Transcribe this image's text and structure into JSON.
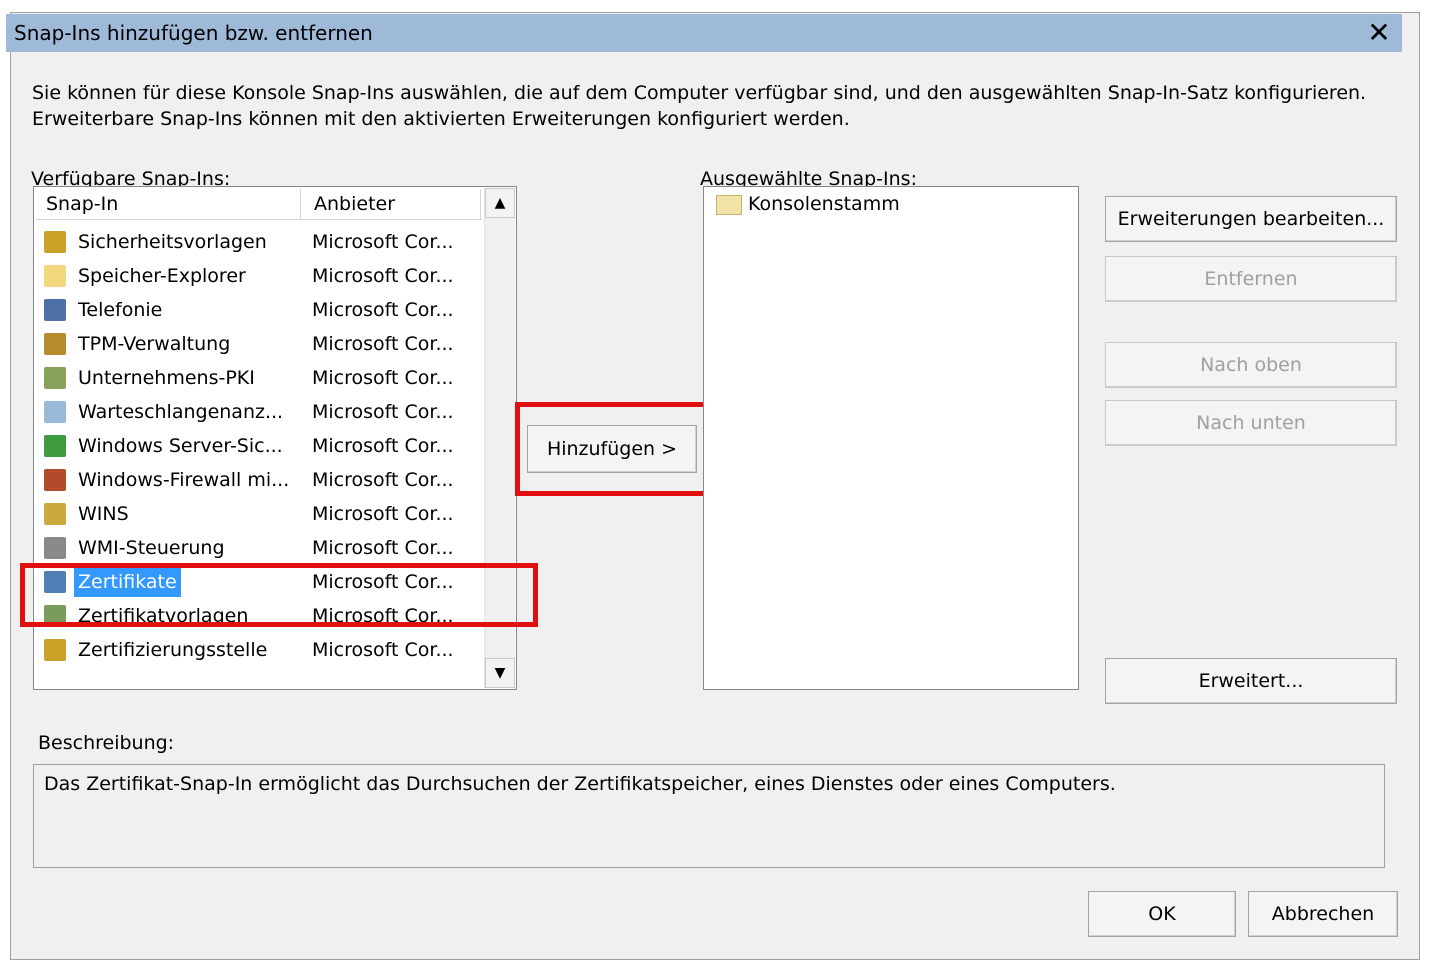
{
  "dialog": {
    "title": "Snap-Ins hinzufügen bzw. entfernen",
    "close_label": "✕",
    "intro": "Sie können für diese Konsole Snap-Ins auswählen, die auf dem Computer verfügbar sind, und den ausgewählten Snap-In-Satz konfigurieren. Erweiterbare Snap-Ins können mit den aktivierten Erweiterungen konfiguriert werden."
  },
  "available": {
    "label": "Verfügbare Snap-Ins:",
    "col_snapin": "Snap-In",
    "col_vendor": "Anbieter",
    "items": [
      {
        "name": "Sicherheitsvorlagen",
        "vendor": "Microsoft Cor...",
        "icon": "security-template-icon",
        "color": "#c9a227"
      },
      {
        "name": "Speicher-Explorer",
        "vendor": "Microsoft Cor...",
        "icon": "folder-icon",
        "color": "#f2d77c"
      },
      {
        "name": "Telefonie",
        "vendor": "Microsoft Cor...",
        "icon": "telephony-icon",
        "color": "#4f6fa8"
      },
      {
        "name": "TPM-Verwaltung",
        "vendor": "Microsoft Cor...",
        "icon": "tpm-key-icon",
        "color": "#b58b2c"
      },
      {
        "name": "Unternehmens-PKI",
        "vendor": "Microsoft Cor...",
        "icon": "pki-icon",
        "color": "#8aa35c"
      },
      {
        "name": "Warteschlangenanz...",
        "vendor": "Microsoft Cor...",
        "icon": "queue-viewer-icon",
        "color": "#9ab8d8"
      },
      {
        "name": "Windows Server-Sic...",
        "vendor": "Microsoft Cor...",
        "icon": "server-backup-icon",
        "color": "#3f9b3f"
      },
      {
        "name": "Windows-Firewall mi...",
        "vendor": "Microsoft Cor...",
        "icon": "firewall-icon",
        "color": "#b34a2a"
      },
      {
        "name": "WINS",
        "vendor": "Microsoft Cor...",
        "icon": "wins-icon",
        "color": "#caa93e"
      },
      {
        "name": "WMI-Steuerung",
        "vendor": "Microsoft Cor...",
        "icon": "wmi-icon",
        "color": "#8a8a8a"
      },
      {
        "name": "Zertifikate",
        "vendor": "Microsoft Cor...",
        "icon": "certificates-icon",
        "color": "#4f7fb5",
        "selected": true
      },
      {
        "name": "Zertifikatvorlagen",
        "vendor": "Microsoft Cor...",
        "icon": "cert-template-icon",
        "color": "#7a9b5a"
      },
      {
        "name": "Zertifizierungsstelle",
        "vendor": "Microsoft Cor...",
        "icon": "cert-authority-icon",
        "color": "#c9a227"
      }
    ]
  },
  "add_button": "Hinzufügen >",
  "selected": {
    "label": "Ausgewählte Snap-Ins:",
    "items": [
      {
        "name": "Konsolenstamm",
        "icon": "folder-icon"
      }
    ]
  },
  "side_buttons": {
    "edit_extensions": "Erweiterungen bearbeiten...",
    "remove": "Entfernen",
    "move_up": "Nach oben",
    "move_down": "Nach unten",
    "advanced": "Erweitert..."
  },
  "description": {
    "label": "Beschreibung:",
    "text": "Das Zertifikat-Snap-In ermöglicht das Durchsuchen der Zertifikatspeicher, eines Dienstes oder eines Computers."
  },
  "footer": {
    "ok": "OK",
    "cancel": "Abbrechen"
  },
  "scroll": {
    "up": "▲",
    "down": "▼"
  },
  "colors": {
    "title_bar": "#9fbad9",
    "selection": "#3399ff",
    "highlight_box": "#e01010"
  }
}
